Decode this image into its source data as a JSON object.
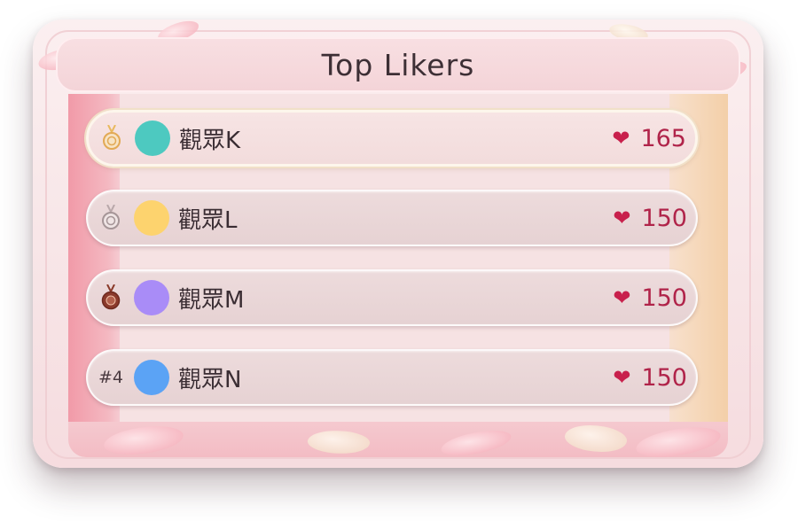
{
  "header": {
    "title": "Top Likers"
  },
  "leaderboard": {
    "entries": [
      {
        "rank_icon": "gold-medal-icon",
        "rank_label": "",
        "name": "觀眾K",
        "avatar_color": "#4dc9c0",
        "likes": "165"
      },
      {
        "rank_icon": "silver-medal-icon",
        "rank_label": "",
        "name": "觀眾L",
        "avatar_color": "#fdd36e",
        "likes": "150"
      },
      {
        "rank_icon": "bronze-medal-icon",
        "rank_label": "",
        "name": "觀眾M",
        "avatar_color": "#a98cf7",
        "likes": "150"
      },
      {
        "rank_icon": "",
        "rank_label": "#4",
        "name": "觀眾N",
        "avatar_color": "#5ba3f5",
        "likes": "150"
      }
    ]
  },
  "colors": {
    "heart": "#c8204c",
    "likes_text": "#b0244a"
  }
}
